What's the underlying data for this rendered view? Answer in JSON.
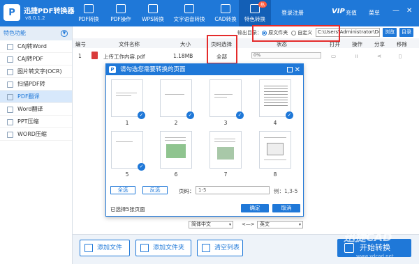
{
  "app": {
    "name": "迅捷PDF转换器",
    "version": "v8.0.1.2",
    "logo_char": "P"
  },
  "nav": [
    {
      "label": "PDF转换"
    },
    {
      "label": "PDF操作"
    },
    {
      "label": "WPS转换"
    },
    {
      "label": "文字语音转换"
    },
    {
      "label": "CAD转换"
    },
    {
      "label": "特色转换",
      "badge": "热"
    }
  ],
  "header": {
    "login": "登录注册",
    "vip": "VIP",
    "vip_label": "充值",
    "menu": "菜单",
    "min": "—",
    "close": "✕"
  },
  "sidebar": {
    "title": "特色功能",
    "items": [
      {
        "label": "CAJ转Word"
      },
      {
        "label": "CAJ转PDF"
      },
      {
        "label": "图片转文字(OCR)"
      },
      {
        "label": "扫描PDF转Word(OCR)"
      },
      {
        "label": "PDF翻译"
      },
      {
        "label": "Word翻译"
      },
      {
        "label": "PPT压缩"
      },
      {
        "label": "WORD压缩"
      }
    ],
    "active_index": 4
  },
  "output": {
    "label": "输出目录：",
    "opt1": "原文件夹",
    "opt2": "自定义",
    "path": "C:\\Users\\Administrator\\Desktop",
    "browse": "浏览",
    "dir": "目录"
  },
  "table": {
    "headers": [
      "编号",
      "文件名称",
      "大小",
      "页码选择",
      "状态",
      "打开",
      "操作",
      "分享",
      "移除"
    ],
    "rows": [
      {
        "num": "1",
        "name": "上传工作内容.pdf",
        "size": "1.18MB",
        "pages": "全部",
        "progress": "0%"
      }
    ]
  },
  "dialog": {
    "title": "请勾选您需要转换的页面",
    "pages": [
      {
        "num": "1",
        "checked": true
      },
      {
        "num": "2",
        "checked": true
      },
      {
        "num": "3",
        "checked": true
      },
      {
        "num": "4",
        "checked": true
      },
      {
        "num": "5",
        "checked": true
      },
      {
        "num": "6",
        "checked": false
      },
      {
        "num": "7",
        "checked": false
      },
      {
        "num": "8",
        "checked": false
      }
    ],
    "select_all": "全选",
    "invert": "反选",
    "page_label": "页码：",
    "page_placeholder": "1-5",
    "example": "例：1,3-5",
    "selected_info": "已选择5张页面",
    "ok": "确定",
    "cancel": "取消"
  },
  "lang": {
    "from": "简体中文",
    "arrow": "<—>",
    "to": "英文"
  },
  "footer": {
    "add_file": "添加文件",
    "add_folder": "添加文件夹",
    "clear": "清空列表",
    "start": "开始转换"
  },
  "watermark": {
    "text": "迅捷CAD",
    "url": "www.xdcad.net"
  },
  "colors": {
    "primary": "#1f78d8",
    "highlight": "#e42b2b"
  }
}
